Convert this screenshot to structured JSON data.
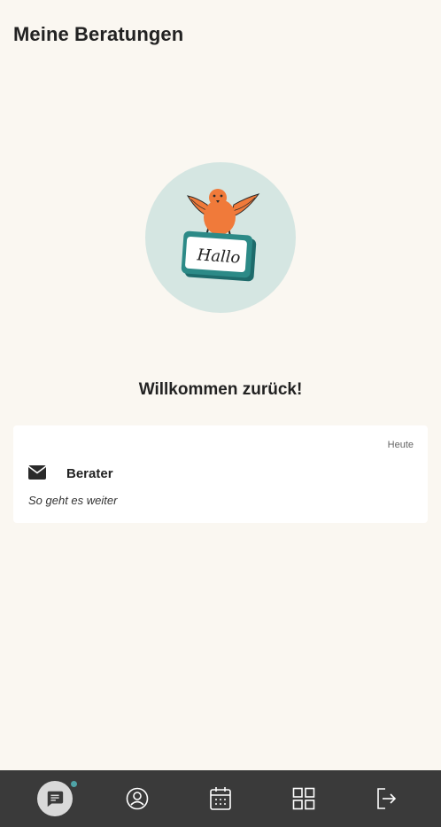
{
  "header": {
    "title": "Meine Beratungen"
  },
  "illustration": {
    "sign_text": "Hallo"
  },
  "welcome": {
    "text": "Willkommen zurück!"
  },
  "session_card": {
    "date": "Heute",
    "sender": "Berater",
    "preview": "So geht es weiter"
  },
  "bottom_nav": {
    "items": [
      {
        "name": "messages",
        "icon": "chat-icon",
        "active": true,
        "has_notification": true
      },
      {
        "name": "profile",
        "icon": "user-icon",
        "active": false
      },
      {
        "name": "appointments",
        "icon": "calendar-icon",
        "active": false
      },
      {
        "name": "tools",
        "icon": "grid-icon",
        "active": false
      },
      {
        "name": "logout",
        "icon": "logout-icon",
        "active": false
      }
    ]
  },
  "colors": {
    "background": "#faf7f1",
    "nav_background": "#3a3a3a",
    "accent": "#4fa3a6",
    "illustration_circle": "#d5e6e2",
    "bird": "#f07a3a"
  }
}
